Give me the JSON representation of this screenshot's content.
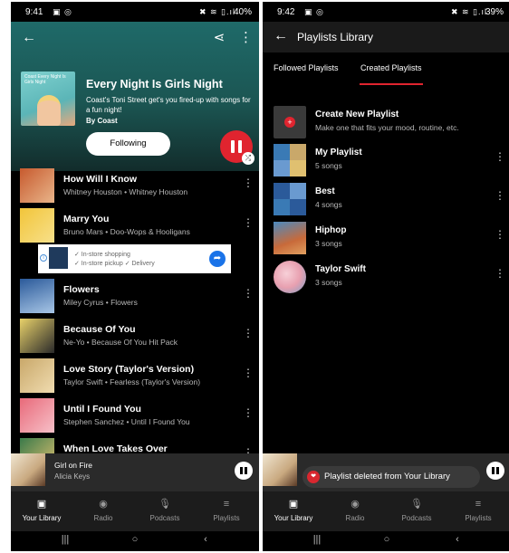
{
  "left": {
    "status": {
      "time": "9:41",
      "left_icons": "▣ ◎",
      "right_icons": "✖ ≋ ▯.ıl",
      "battery": "40%"
    },
    "playlist": {
      "title": "Every Night Is Girls Night",
      "description": "Coast's Toni Street get's you fired-up with songs for a fun night!",
      "by": "By Coast",
      "follow_label": "Following",
      "cover_text": "Coast Every Night Is Girls Night"
    },
    "songs": [
      {
        "title": "How Will I Know",
        "sub": "Whitney Houston • Whitney Houston",
        "colors": [
          "#c75a2e",
          "#e9b58a"
        ]
      },
      {
        "title": "Marry You",
        "sub": "Bruno Mars • Doo-Wops & Hooligans",
        "colors": [
          "#f2c53a",
          "#f7e08a"
        ]
      },
      {
        "title": "Flowers",
        "sub": "Miley Cyrus • Flowers",
        "colors": [
          "#2b5a9a",
          "#a8c6e6"
        ]
      },
      {
        "title": "Because Of You",
        "sub": "Ne-Yo • Because Of You Hit Pack",
        "colors": [
          "#e9d26a",
          "#2a2a2a"
        ]
      },
      {
        "title": "Love Story (Taylor's Version)",
        "sub": "Taylor Swift • Fearless (Taylor's Version)",
        "colors": [
          "#c9a86a",
          "#f0dcb0"
        ]
      },
      {
        "title": "Until I Found You",
        "sub": "Stephen Sanchez • Until I Found You",
        "colors": [
          "#e86a7a",
          "#f7c0c8"
        ]
      },
      {
        "title": "When Love Takes Over",
        "sub": "",
        "colors": [
          "#3a7a4a",
          "#e0c070"
        ]
      }
    ],
    "ad": {
      "line1": "✓ In-store shopping",
      "line2a": "✓ In-store pickup",
      "line2b": "✓ Delivery",
      "info": "i",
      "arrow": "➦"
    },
    "now_playing": {
      "title": "Girl on Fire",
      "artist": "Alicia Keys"
    },
    "icons": {
      "back": "back-arrow-icon",
      "share": "share-icon",
      "more": "more-vert-icon"
    }
  },
  "right": {
    "status": {
      "time": "9:42",
      "left_icons": "▣ ◎",
      "right_icons": "✖ ≋ ▯.ıl",
      "battery": "39%"
    },
    "title": "Playlists Library",
    "tabs": [
      {
        "label": "Followed Playlists"
      },
      {
        "label": "Created Playlists"
      }
    ],
    "items": [
      {
        "name": "Create New Playlist",
        "sub": "Make one that fits your mood, routine, etc."
      },
      {
        "name": "My Playlist",
        "sub": "5 songs",
        "colors": [
          "#3a7ab5",
          "#c9a86a",
          "#6a9ad0",
          "#e0c070"
        ]
      },
      {
        "name": "Best",
        "sub": "4 songs",
        "colors": [
          "#2b5a9a",
          "#6a9ad0",
          "#3a7ab5",
          "#2b5a9a"
        ]
      },
      {
        "name": "Hiphop",
        "sub": "3 songs",
        "colors": [
          "#c86a3a"
        ]
      },
      {
        "name": "Taylor Swift",
        "sub": "3 songs",
        "colors": [
          "#e8a0b0"
        ]
      }
    ],
    "toast": "Playlist deleted from Your Library",
    "now_playing": {
      "title": "Girl on Fire",
      "artist": "Alicia Keys"
    }
  },
  "nav": [
    {
      "label": "Your Library",
      "icon": "library-icon",
      "glyph": "▣"
    },
    {
      "label": "Radio",
      "icon": "radio-icon",
      "glyph": "◉"
    },
    {
      "label": "Podcasts",
      "icon": "microphone-icon",
      "glyph": "🎙"
    },
    {
      "label": "Playlists",
      "icon": "playlist-icon",
      "glyph": "≡"
    }
  ],
  "sysnav": {
    "recents": "|||",
    "home": "○",
    "back": "‹"
  },
  "accent": "#e0242f"
}
